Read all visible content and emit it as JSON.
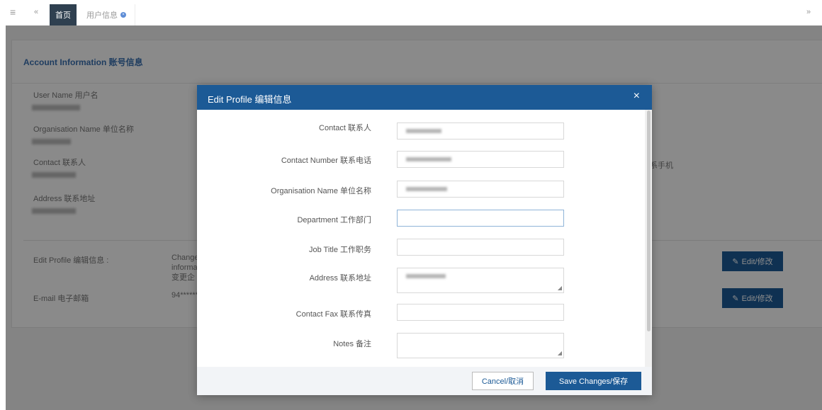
{
  "tabs": {
    "home_label": "首页",
    "user_label": "用户信息"
  },
  "panel": {
    "title": "Account Information 账号信息",
    "fields": [
      {
        "label": "User Name 用户名"
      },
      {
        "label": "Organisation Name 单位名称"
      },
      {
        "label": "Contact 联系人"
      },
      {
        "label": "Address 联系地址"
      }
    ],
    "right_partial_label": "系手机",
    "rows": [
      {
        "label": "Edit Profile 编辑信息 :",
        "value_lines": [
          "Change",
          "informa",
          "变更企"
        ],
        "button": "Edit/修改"
      },
      {
        "label": "E-mail 电子邮箱",
        "value_lines": [
          "94*******"
        ],
        "button": "Edit/修改"
      }
    ]
  },
  "modal": {
    "title": "Edit Profile 编辑信息",
    "close_glyph": "×",
    "fields": [
      {
        "label": "Contact 联系人",
        "value": ""
      },
      {
        "label": "Contact Number 联系电话",
        "value": ""
      },
      {
        "label": "Organisation Name 单位名称",
        "value": ""
      },
      {
        "label": "Department 工作部门",
        "value": ""
      },
      {
        "label": "Job Title 工作职务",
        "value": ""
      },
      {
        "label": "Address 联系地址",
        "value": ""
      },
      {
        "label": "Contact Fax 联系传真",
        "value": ""
      },
      {
        "label": "Notes 备注",
        "value": ""
      }
    ],
    "cancel_label": "Cancel/取消",
    "save_label": "Save Changes/保存"
  },
  "icons": {
    "menu": "hamburger-icon",
    "back": "double-left-arrow-icon",
    "forward": "double-right-arrow-icon",
    "edit": "edit-icon"
  },
  "colors": {
    "primary": "#1c5a96",
    "tab_active": "#2f4050",
    "title_blue": "#3a6fb0"
  }
}
